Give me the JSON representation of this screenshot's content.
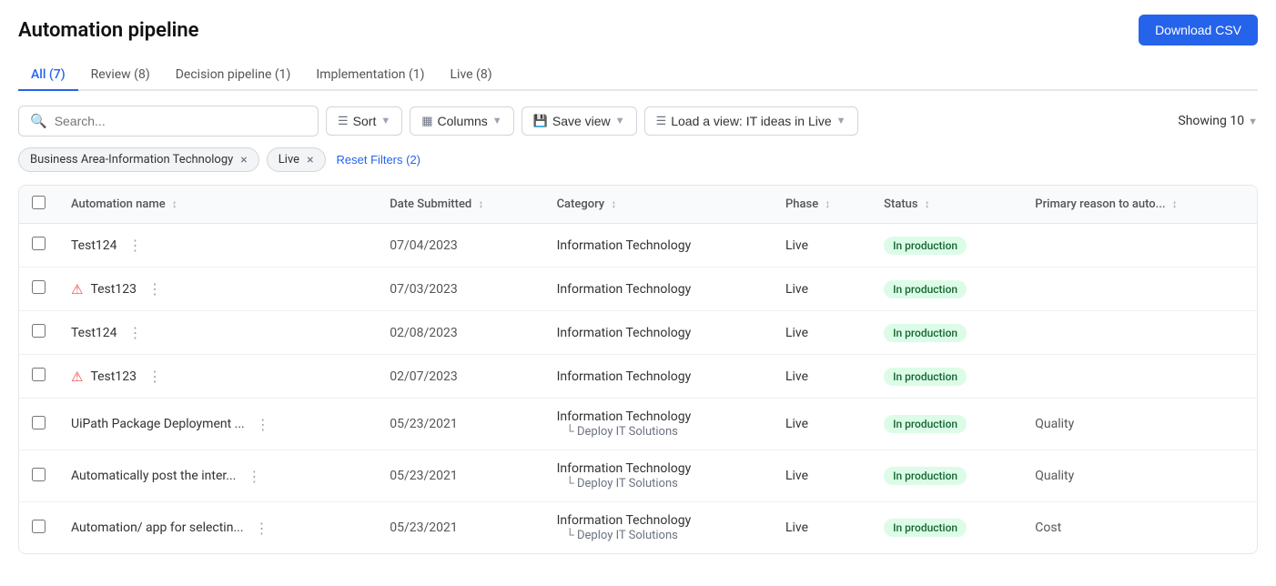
{
  "page": {
    "title": "Automation pipeline",
    "download_btn": "Download CSV"
  },
  "tabs": [
    {
      "id": "all",
      "label": "All (7)",
      "active": true
    },
    {
      "id": "review",
      "label": "Review (8)",
      "active": false
    },
    {
      "id": "decision",
      "label": "Decision pipeline (1)",
      "active": false
    },
    {
      "id": "implementation",
      "label": "Implementation (1)",
      "active": false
    },
    {
      "id": "live",
      "label": "Live (8)",
      "active": false
    }
  ],
  "toolbar": {
    "search_placeholder": "Search...",
    "sort_label": "Sort",
    "columns_label": "Columns",
    "save_view_label": "Save view",
    "load_view_label": "Load a view: IT ideas in Live",
    "showing_label": "Showing 10"
  },
  "filters": [
    {
      "id": "biz-area",
      "label": "Business Area-Information Technology"
    },
    {
      "id": "live",
      "label": "Live"
    }
  ],
  "reset_filters_label": "Reset Filters (2)",
  "table": {
    "columns": [
      {
        "id": "name",
        "label": "Automation name",
        "sortable": true
      },
      {
        "id": "date",
        "label": "Date Submitted",
        "sortable": true
      },
      {
        "id": "category",
        "label": "Category",
        "sortable": true
      },
      {
        "id": "phase",
        "label": "Phase",
        "sortable": true
      },
      {
        "id": "status",
        "label": "Status",
        "sortable": true
      },
      {
        "id": "primary",
        "label": "Primary reason to auto...",
        "sortable": true
      }
    ],
    "rows": [
      {
        "id": 1,
        "name": "Test124",
        "has_error": false,
        "date": "07/04/2023",
        "category": "Information Technology",
        "sub_category": "",
        "phase": "Live",
        "status": "In production",
        "primary": ""
      },
      {
        "id": 2,
        "name": "Test123",
        "has_error": true,
        "date": "07/03/2023",
        "category": "Information Technology",
        "sub_category": "",
        "phase": "Live",
        "status": "In production",
        "primary": ""
      },
      {
        "id": 3,
        "name": "Test124",
        "has_error": false,
        "date": "02/08/2023",
        "category": "Information Technology",
        "sub_category": "",
        "phase": "Live",
        "status": "In production",
        "primary": ""
      },
      {
        "id": 4,
        "name": "Test123",
        "has_error": true,
        "date": "02/07/2023",
        "category": "Information Technology",
        "sub_category": "",
        "phase": "Live",
        "status": "In production",
        "primary": ""
      },
      {
        "id": 5,
        "name": "UiPath Package Deployment ...",
        "has_error": false,
        "date": "05/23/2021",
        "category": "Information Technology",
        "sub_category": "Deploy IT Solutions",
        "phase": "Live",
        "status": "In production",
        "primary": "Quality"
      },
      {
        "id": 6,
        "name": "Automatically post the inter...",
        "has_error": false,
        "date": "05/23/2021",
        "category": "Information Technology",
        "sub_category": "Deploy IT Solutions",
        "phase": "Live",
        "status": "In production",
        "primary": "Quality"
      },
      {
        "id": 7,
        "name": "Automation/ app for selectin...",
        "has_error": false,
        "date": "05/23/2021",
        "category": "Information Technology",
        "sub_category": "Deploy IT Solutions",
        "phase": "Live",
        "status": "In production",
        "primary": "Cost"
      }
    ]
  }
}
